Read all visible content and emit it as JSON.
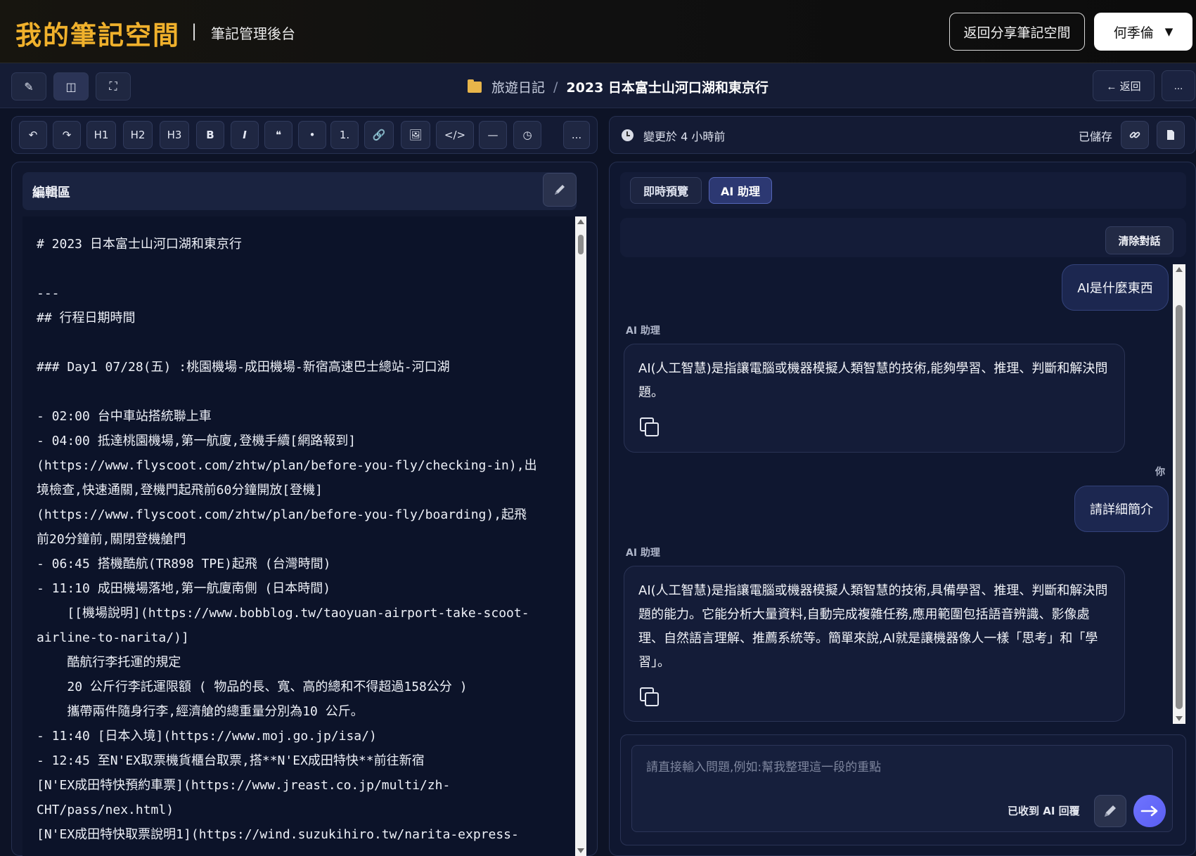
{
  "header": {
    "brand": "我的筆記空間",
    "separator": "|",
    "subtitle": "筆記管理後台",
    "share_button": "返回分享筆記空間",
    "user_name": "何季倫",
    "user_caret": "▼"
  },
  "subbar": {
    "tools": [
      "✎",
      "◫",
      "⛶"
    ],
    "breadcrumb_folder": "旅遊日記",
    "breadcrumb_sep": "/",
    "breadcrumb_note": "2023 日本富士山河口湖和東京行",
    "back_button": "← 返回",
    "more_button": "..."
  },
  "editor_toolbar": {
    "buttons": [
      {
        "id": "undo",
        "label": "↶"
      },
      {
        "id": "redo",
        "label": "↷"
      },
      {
        "id": "h1",
        "label": "H1"
      },
      {
        "id": "h2",
        "label": "H2"
      },
      {
        "id": "h3",
        "label": "H3"
      },
      {
        "id": "bold",
        "label": "B"
      },
      {
        "id": "italic",
        "label": "I"
      },
      {
        "id": "quote",
        "label": "❝"
      },
      {
        "id": "bullet",
        "label": "•"
      },
      {
        "id": "ordered",
        "label": "1."
      },
      {
        "id": "link",
        "label": "🔗"
      },
      {
        "id": "image",
        "label": "🖼"
      },
      {
        "id": "code",
        "label": "</>"
      },
      {
        "id": "hr",
        "label": "—"
      },
      {
        "id": "time",
        "label": "◷"
      },
      {
        "id": "more",
        "label": "..."
      }
    ]
  },
  "editor": {
    "title": "編輯區",
    "lines": [
      "# 2023 日本富士山河口湖和東京行",
      "",
      "---",
      "## 行程日期時間",
      "",
      "### Day1 07/28(五) :桃園機場-成田機場-新宿高速巴士總站-河口湖",
      "",
      "- 02:00 台中車站搭統聯上車",
      "- 04:00 抵達桃園機場,第一航廈,登機手續[網路報到]",
      "(https://www.flyscoot.com/zhtw/plan/before-you-fly/checking-in),出",
      "境檢查,快速通關,登機門起飛前60分鐘開放[登機]",
      "(https://www.flyscoot.com/zhtw/plan/before-you-fly/boarding),起飛",
      "前20分鐘前,關閉登機艙門",
      "- 06:45 搭機酷航(TR898 TPE)起飛 (台灣時間)",
      "- 11:10 成田機場落地,第一航廈南側 (日本時間)",
      "    [[機場說明](https://www.bobblog.tw/taoyuan-airport-take-scoot-",
      "airline-to-narita/)]",
      "    酷航行李托運的規定",
      "    20 公斤行李託運限額 ( 物品的長、寬、高的總和不得超過158公分 )",
      "    攜帶兩件隨身行李,經濟艙的總重量分別為10 公斤。",
      "- 11:40 [日本入境](https://www.moj.go.jp/isa/)",
      "- 12:45 至N'EX取票機貨櫃台取票,搭**N'EX成田特快**前往新宿",
      "[N'EX成田特快預約車票](https://www.jreast.co.jp/multi/zh-",
      "CHT/pass/nex.html)",
      "[N'EX成田特快取票說明1](https://wind.suzukihiro.tw/narita-express-"
    ]
  },
  "status": {
    "changed_text": "變更於 4 小時前",
    "saved_text": "已儲存"
  },
  "tabs": {
    "preview": "即時預覽",
    "ai": "AI 助理"
  },
  "chat": {
    "clear_button": "清除對話",
    "messages": [
      {
        "role": "user",
        "text": "AI是什麼東西"
      },
      {
        "role": "ai",
        "label": "AI 助理",
        "text": "AI(人工智慧)是指讓電腦或機器模擬人類智慧的技術,能夠學習、推理、判斷和解決問題。"
      },
      {
        "role": "user",
        "label": "你",
        "text": "請詳細簡介"
      },
      {
        "role": "ai",
        "label": "AI 助理",
        "text": "AI(人工智慧)是指讓電腦或機器模擬人類智慧的技術,具備學習、推理、判斷和解決問題的能力。它能分析大量資料,自動完成複雜任務,應用範圍包括語音辨識、影像處理、自然語言理解、推薦系統等。簡單來說,AI就是讓機器像人一樣「思考」和「學習」。"
      }
    ],
    "input_placeholder": "請直接輸入問題,例如:幫我整理這一段的重點",
    "received_text": "已收到 AI 回覆"
  },
  "colors": {
    "brand": "#f0b12c",
    "accent": "#5a5ef2"
  }
}
